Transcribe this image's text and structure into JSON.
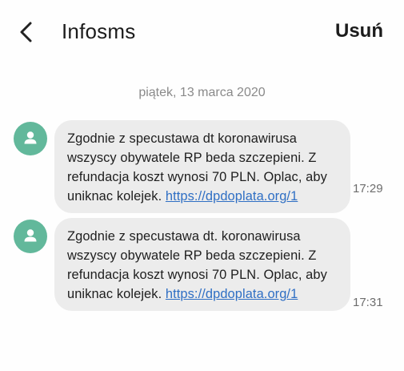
{
  "header": {
    "back_icon": "chevron-left-icon",
    "title": "Infosms",
    "delete_label": "Usuń"
  },
  "conversation": {
    "date_separator": "piątek, 13 marca 2020",
    "messages": [
      {
        "avatar_icon": "person-icon",
        "text": "Zgodnie z specustawa dt koronawirusa\nwszyscy obywatele RP beda szczepieni. Z\nrefundacja koszt wynosi 70 PLN. Oplac, aby\nuniknac kolejek. ",
        "link": "https://dpdoplata.org/1",
        "time": "17:29"
      },
      {
        "avatar_icon": "person-icon",
        "text": "Zgodnie z specustawa dt. koronawirusa\nwszyscy obywatele RP beda szczepieni. Z\nrefundacja koszt wynosi 70 PLN. Oplac, aby\nuniknac kolejek. ",
        "link": "https://dpdoplata.org/1",
        "time": "17:31"
      }
    ]
  },
  "colors": {
    "avatar": "#62b89b",
    "bubble": "#ececec",
    "link": "#2f6fc4"
  }
}
